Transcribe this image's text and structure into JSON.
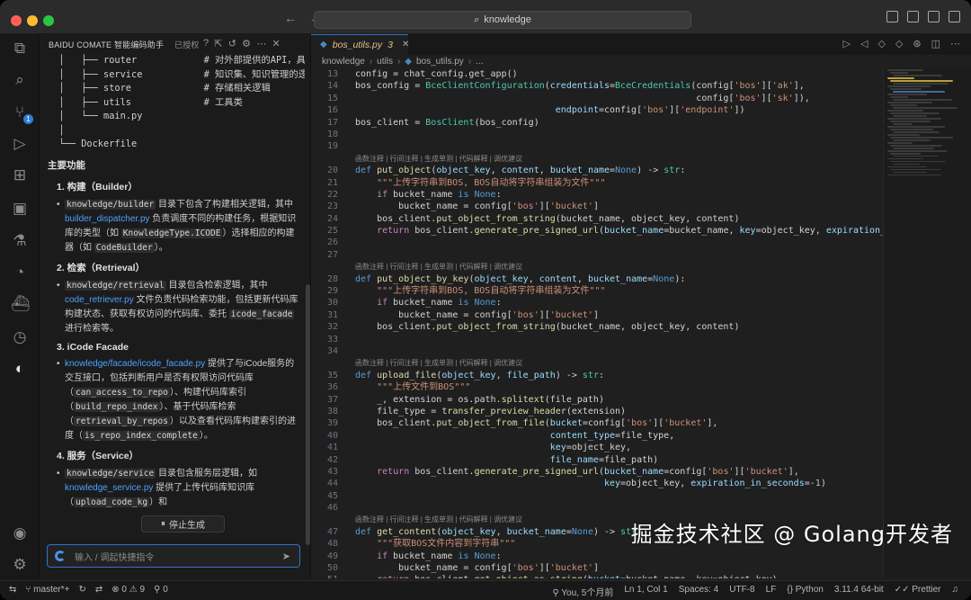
{
  "window": {
    "search_text": "knowledge",
    "nav_back": "←",
    "nav_forward": "→"
  },
  "activity_bar": {
    "items": [
      {
        "icon": "files-icon",
        "glyph": "⧉"
      },
      {
        "icon": "search-icon",
        "glyph": "⌕"
      },
      {
        "icon": "source-control-icon",
        "glyph": "⑂",
        "badge": "1"
      },
      {
        "icon": "run-debug-icon",
        "glyph": "▷"
      },
      {
        "icon": "extensions-icon",
        "glyph": "⊞"
      },
      {
        "icon": "remote-explorer-icon",
        "glyph": "▣"
      },
      {
        "icon": "testing-icon",
        "glyph": "⚗"
      },
      {
        "icon": "gitlens-icon",
        "glyph": "◔"
      },
      {
        "icon": "docker-icon",
        "glyph": "⛴"
      },
      {
        "icon": "timeline-icon",
        "glyph": "◷"
      },
      {
        "icon": "comate-icon",
        "glyph": "◐"
      }
    ],
    "account_glyph": "◉",
    "settings_glyph": "⚙"
  },
  "panel": {
    "title": "BAIDU COMATE 智能编码助手",
    "auth_label": "已授权",
    "tree_lines": [
      "  │   ├── router            # 对外部提供的API，具备简单",
      "  │   ├── service           # 知识集、知识管理的逻辑封装",
      "  │   ├── store             # 存储相关逻辑",
      "  │   ├── utils             # 工具类",
      "  │   └── main.py",
      "  │",
      "  └── Dockerfile"
    ],
    "section_title": "主要功能",
    "items": [
      {
        "head": "1. 构建（Builder）",
        "parts": [
          {
            "t": "code",
            "v": "knowledge/builder"
          },
          {
            "t": "text",
            "v": " 目录下包含了构建相关逻辑，其中 "
          },
          {
            "t": "link",
            "v": "builder_dispatcher.py"
          },
          {
            "t": "text",
            "v": " 负责调度不同的构建任务，根据知识库的类型（如 "
          },
          {
            "t": "code",
            "v": "KnowledgeType.ICODE"
          },
          {
            "t": "text",
            "v": "）选择相应的构建器（如 "
          },
          {
            "t": "code",
            "v": "CodeBuilder"
          },
          {
            "t": "text",
            "v": "）。"
          }
        ]
      },
      {
        "head": "2. 检索（Retrieval）",
        "parts": [
          {
            "t": "code",
            "v": "knowledge/retrieval"
          },
          {
            "t": "text",
            "v": " 目录包含检索逻辑，其中 "
          },
          {
            "t": "link",
            "v": "code_retriever.py"
          },
          {
            "t": "text",
            "v": " 文件负责代码检索功能，包括更新代码库构建状态、获取有权访问的代码库、委托 "
          },
          {
            "t": "code",
            "v": "icode_facade"
          },
          {
            "t": "text",
            "v": " 进行检索等。"
          }
        ]
      },
      {
        "head": "3. iCode Facade",
        "parts": [
          {
            "t": "link",
            "v": "knowledge/facade/icode_facade.py"
          },
          {
            "t": "text",
            "v": " 提供了与iCode服务的交互接口，包括判断用户是否有权限访问代码库（"
          },
          {
            "t": "code",
            "v": "can_access_to_repo"
          },
          {
            "t": "text",
            "v": "）、构建代码库索引（"
          },
          {
            "t": "code",
            "v": "build_repo_index"
          },
          {
            "t": "text",
            "v": "）、基于代码库检索（"
          },
          {
            "t": "code",
            "v": "retrieval_by_repos"
          },
          {
            "t": "text",
            "v": "）以及查看代码库构建索引的进度（"
          },
          {
            "t": "code",
            "v": "is_repo_index_complete"
          },
          {
            "t": "text",
            "v": "）。"
          }
        ]
      },
      {
        "head": "4. 服务（Service）",
        "parts": [
          {
            "t": "code",
            "v": "knowledge/service"
          },
          {
            "t": "text",
            "v": " 目录包含服务层逻辑，如 "
          },
          {
            "t": "link",
            "v": "knowledge_service.py"
          },
          {
            "t": "text",
            "v": " 提供了上传代码库知识库（"
          },
          {
            "t": "code",
            "v": "upload_code_kg"
          },
          {
            "t": "text",
            "v": "）和"
          }
        ]
      }
    ],
    "stop_button": "停止生成",
    "chat_placeholder": "输入 / 调起快捷指令"
  },
  "editor": {
    "tab": {
      "name": "bos_utils.py",
      "modified_count": "3"
    },
    "breadcrumb": [
      "knowledge",
      "utils",
      "bos_utils.py",
      "..."
    ],
    "codelens": "函数注释 | 行间注释 | 生成单测 | 代码解释 | 调优建议",
    "lines": [
      {
        "n": "13",
        "h": "config = chat_config.get_app()"
      },
      {
        "n": "14",
        "h": "bos_config = <span class=\"ty\">BceClientConfiguration</span>(<span class=\"var\">credentials</span>=<span class=\"ty\">BceCredentials</span>(config[<span class=\"str\">'bos'</span>][<span class=\"str\">'ak'</span>],"
      },
      {
        "n": "15",
        "h": "                                                               config[<span class=\"str\">'bos'</span>][<span class=\"str\">'sk'</span>]),"
      },
      {
        "n": "16",
        "h": "                                     <span class=\"var\">endpoint</span>=config[<span class=\"str\">'bos'</span>][<span class=\"str\">'endpoint'</span>])"
      },
      {
        "n": "17",
        "h": "bos_client = <span class=\"ty\">BosClient</span>(bos_config)"
      },
      {
        "n": "18",
        "h": ""
      },
      {
        "n": "19",
        "h": ""
      },
      {
        "lens": true
      },
      {
        "n": "20",
        "h": "<span class=\"kw2\">def</span> <span class=\"fn\">put_object</span>(<span class=\"var\">object_key</span>, <span class=\"var\">content</span>, <span class=\"var\">bucket_name</span>=<span class=\"kw2\">None</span>) -&gt; <span class=\"ty\">str</span>:"
      },
      {
        "n": "21",
        "h": "    <span class=\"str\">\"\"\"上传字符串到BOS, BOS自动将字符串组装为文件\"\"\"</span>"
      },
      {
        "n": "22",
        "h": "    <span class=\"kw\">if</span> bucket_name <span class=\"kw2\">is</span> <span class=\"kw2\">None</span>:"
      },
      {
        "n": "23",
        "h": "        bucket_name = config[<span class=\"str\">'bos'</span>][<span class=\"str\">'bucket'</span>]"
      },
      {
        "n": "24",
        "h": "    bos_client.<span class=\"fn\">put_object_from_string</span>(bucket_name, object_key, content)"
      },
      {
        "n": "25",
        "h": "    <span class=\"kw\">return</span> bos_client.<span class=\"fn\">generate_pre_signed_url</span>(<span class=\"var\">bucket_name</span>=bucket_name, <span class=\"var\">key</span>=object_key, <span class=\"var\">expiration_in_seconds</span>=-"
      },
      {
        "n": "26",
        "h": ""
      },
      {
        "n": "27",
        "h": ""
      },
      {
        "lens": true
      },
      {
        "n": "28",
        "h": "<span class=\"kw2\">def</span> <span class=\"fn\">put_object_by_key</span>(<span class=\"var\">object_key</span>, <span class=\"var\">content</span>, <span class=\"var\">bucket_name</span>=<span class=\"kw2\">None</span>):"
      },
      {
        "n": "29",
        "h": "    <span class=\"str\">\"\"\"上传字符串到BOS, BOS自动将字符串组装为文件\"\"\"</span>"
      },
      {
        "n": "30",
        "h": "    <span class=\"kw\">if</span> bucket_name <span class=\"kw2\">is</span> <span class=\"kw2\">None</span>:"
      },
      {
        "n": "31",
        "h": "        bucket_name = config[<span class=\"str\">'bos'</span>][<span class=\"str\">'bucket'</span>]"
      },
      {
        "n": "32",
        "h": "    bos_client.<span class=\"fn\">put_object_from_string</span>(bucket_name, object_key, content)"
      },
      {
        "n": "33",
        "h": ""
      },
      {
        "n": "34",
        "h": ""
      },
      {
        "lens": true
      },
      {
        "n": "35",
        "h": "<span class=\"kw2\">def</span> <span class=\"fn\">upload_file</span>(<span class=\"var\">object_key</span>, <span class=\"var\">file_path</span>) -&gt; <span class=\"ty\">str</span>:"
      },
      {
        "n": "36",
        "h": "    <span class=\"str\">\"\"\"上传文件到BOS\"\"\"</span>"
      },
      {
        "n": "37",
        "h": "    _, extension = os.path.<span class=\"fn\">splitext</span>(file_path)"
      },
      {
        "n": "38",
        "h": "    file_type = <span class=\"fn\">transfer_preview_header</span>(extension)"
      },
      {
        "n": "39",
        "h": "    bos_client.<span class=\"fn\">put_object_from_file</span>(<span class=\"var\">bucket</span>=config[<span class=\"str\">'bos'</span>][<span class=\"str\">'bucket'</span>],"
      },
      {
        "n": "40",
        "h": "                                    <span class=\"var\">content_type</span>=file_type,"
      },
      {
        "n": "41",
        "h": "                                    <span class=\"var\">key</span>=object_key,"
      },
      {
        "n": "42",
        "h": "                                    <span class=\"var\">file_name</span>=file_path)"
      },
      {
        "n": "43",
        "h": "    <span class=\"kw\">return</span> bos_client.<span class=\"fn\">generate_pre_signed_url</span>(<span class=\"var\">bucket_name</span>=config[<span class=\"str\">'bos'</span>][<span class=\"str\">'bucket'</span>],"
      },
      {
        "n": "44",
        "h": "                                              <span class=\"var\">key</span>=object_key, <span class=\"var\">expiration_in_seconds</span>=<span class=\"num\">-1</span>)"
      },
      {
        "n": "45",
        "h": ""
      },
      {
        "n": "46",
        "h": ""
      },
      {
        "lens": true
      },
      {
        "n": "47",
        "h": "<span class=\"kw2\">def</span> <span class=\"fn\">get_content</span>(<span class=\"var\">object_key</span>, <span class=\"var\">bucket_name</span>=<span class=\"kw2\">None</span>) -&gt; <span class=\"ty\">str</span>:"
      },
      {
        "n": "48",
        "h": "    <span class=\"str\">\"\"\"获取BOS文件内容到字符串\"\"\"</span>"
      },
      {
        "n": "49",
        "h": "    <span class=\"kw\">if</span> bucket_name <span class=\"kw2\">is</span> <span class=\"kw2\">None</span>:"
      },
      {
        "n": "50",
        "h": "        bucket_name = config[<span class=\"str\">'bos'</span>][<span class=\"str\">'bucket'</span>]"
      },
      {
        "n": "51",
        "h": "    <span class=\"kw\">return</span> bos_client.<span class=\"fn\">get_object_as_string</span>(<span class=\"var\">bucket</span>=bucket_name, <span class=\"var\">key</span>=object_key)"
      }
    ]
  },
  "watermark": "掘金技术社区 @ Golang开发者",
  "statusbar": {
    "branch": "master*+",
    "errors": "0",
    "warnings": "9",
    "ports": "0",
    "blame": "You, 5个月前",
    "position": "Ln 1, Col 1",
    "spaces": "Spaces: 4",
    "encoding": "UTF-8",
    "eol": "LF",
    "language": "Python",
    "interpreter": "3.11.4 64-bit",
    "formatter": "Prettier"
  }
}
